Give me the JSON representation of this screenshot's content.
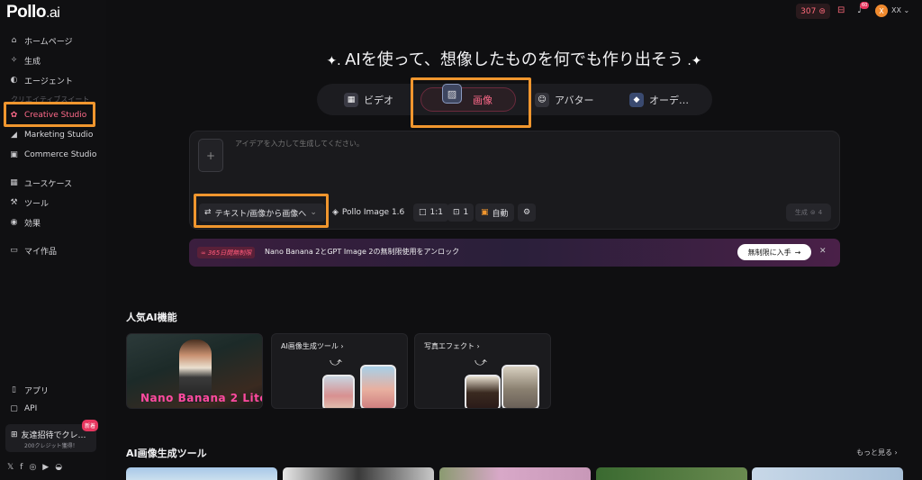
{
  "brand": {
    "logo_main": "Pollo",
    "logo_suffix": ".ai"
  },
  "sidebar": {
    "items": [
      {
        "label": "ホームページ",
        "icon": "home-icon"
      },
      {
        "label": "生成",
        "icon": "sparkle-icon"
      },
      {
        "label": "エージェント",
        "icon": "agent-icon"
      }
    ],
    "section_label": "クリエイティブスイート",
    "suite_items": [
      {
        "label": "Creative Studio",
        "icon": "palette-icon"
      },
      {
        "label": "Marketing Studio",
        "icon": "megaphone-icon"
      },
      {
        "label": "Commerce Studio",
        "icon": "shop-icon"
      }
    ],
    "more_items": [
      {
        "label": "ユースケース",
        "icon": "grid-icon"
      },
      {
        "label": "ツール",
        "icon": "wrench-icon"
      },
      {
        "label": "効果",
        "icon": "effects-icon"
      }
    ],
    "my_works": "マイ作品",
    "bottom_items": [
      {
        "label": "アプリ",
        "icon": "phone-icon"
      },
      {
        "label": "API",
        "icon": "api-icon"
      }
    ],
    "invite": {
      "title": "友達招待でクレ…",
      "subtitle": "200クレジット獲得！",
      "badge": "新着"
    }
  },
  "topbar": {
    "credits": "307",
    "notification_count": "60",
    "avatar_initial": "X",
    "user_name": "XX"
  },
  "main": {
    "heading": "AIを使って、想像したものを何でも作り出そう",
    "tabs": [
      {
        "label": "ビデオ",
        "icon": "video-icon"
      },
      {
        "label": "画像",
        "icon": "image-icon"
      },
      {
        "label": "アバター",
        "icon": "avatar-icon"
      },
      {
        "label": "オーデ…",
        "icon": "audio-icon"
      }
    ],
    "prompt": {
      "placeholder": "アイデアを入力して生成してください。",
      "mode": "テキスト/画像から画像へ",
      "model": "Pollo Image 1.6",
      "ratio": "1:1",
      "count": "1",
      "style": "自動",
      "generate_label": "生成",
      "generate_cost": "4"
    },
    "banner": {
      "tag": "365日間無制限",
      "message": "Nano Banana 2とGPT Image 2の無制限使用をアンロック",
      "cta": "無制限に入手"
    },
    "popular": {
      "title": "人気AI機能",
      "cards": [
        {
          "title": "",
          "overlay": "Nano Banana 2 Lite"
        },
        {
          "title": "AI画像生成ツール"
        },
        {
          "title": "写真エフェクト"
        }
      ]
    },
    "tools_section": {
      "title": "AI画像生成ツール",
      "more": "もっと見る"
    }
  }
}
